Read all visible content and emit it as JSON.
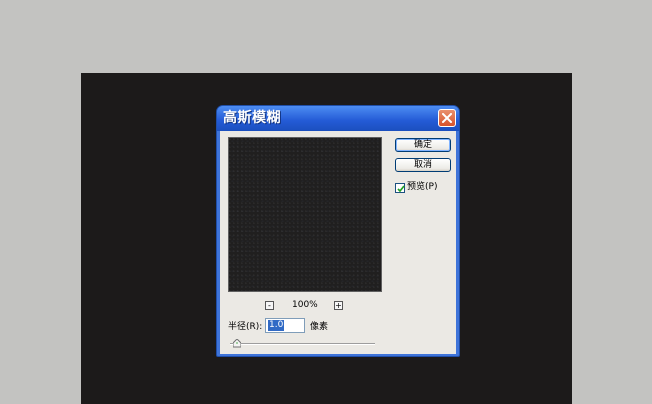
{
  "dialog": {
    "title": "高斯模糊",
    "close_icon": "close-icon",
    "ok_label": "确定",
    "cancel_label": "取消",
    "preview_checkbox": {
      "label": "预览(P)",
      "checked": true
    },
    "zoom": {
      "out_label": "-",
      "level": "100%",
      "in_label": "+"
    },
    "radius": {
      "label": "半径(R):",
      "value": "1.0",
      "unit": "像素",
      "slider_icon": "slider-thumb-icon"
    }
  },
  "colors": {
    "workspace": "#c3c3c1",
    "canvas": "#1c1a1a",
    "dialog_title_blue": "#245bd6",
    "dialog_face": "#ebe9e4",
    "close_red": "#d9532c"
  }
}
